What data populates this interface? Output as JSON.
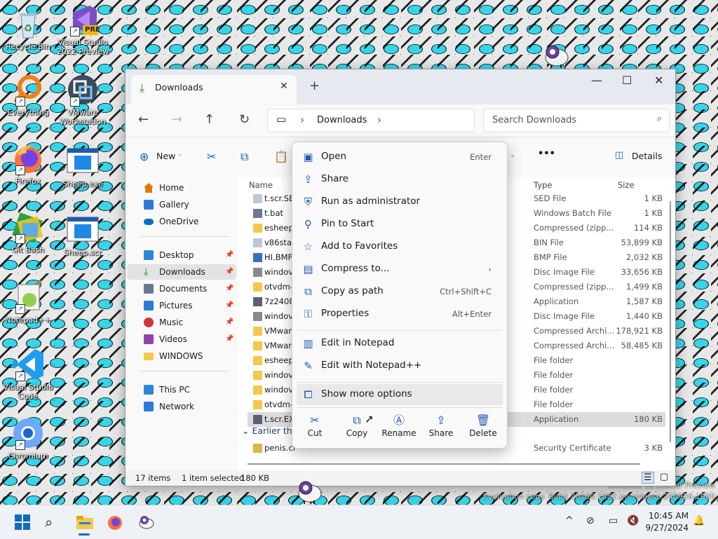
{
  "desktop_icons": [
    {
      "label": "Recycle Bin"
    },
    {
      "label": "Visual Studio 2022 Preview",
      "badge": "PRE"
    },
    {
      "label": "Everything"
    },
    {
      "label": "VMware Workstation"
    },
    {
      "label": "Firefox"
    },
    {
      "label": "Sheep.exe"
    },
    {
      "label": "Git Bash"
    },
    {
      "label": "Sheep.scr"
    },
    {
      "label": "Notepad++"
    },
    {
      "label": "Visual Studio Code"
    },
    {
      "label": "Chromium"
    }
  ],
  "window": {
    "tab_title": "Downloads",
    "tab_close": "✕",
    "new_tab": "+",
    "address": {
      "pc_glyph": "▭",
      "sep": "›",
      "location": "Downloads",
      "sep2": "›"
    },
    "search_placeholder": "Search Downloads",
    "toolbar": {
      "new_label": "New",
      "more": "•••",
      "details_label": "Details"
    },
    "nav_pane": [
      {
        "label": "Home",
        "color": "#e07b00"
      },
      {
        "label": "Gallery",
        "color": "#2b79d8"
      },
      {
        "label": "OneDrive",
        "color": "#0f6cbd"
      },
      {
        "label": "Desktop",
        "color": "#2b88d8",
        "pinned": true
      },
      {
        "label": "Downloads",
        "color": "#1a7f37",
        "pinned": true,
        "selected": true
      },
      {
        "label": "Documents",
        "color": "#6b7a90",
        "pinned": true
      },
      {
        "label": "Pictures",
        "color": "#2b79d8",
        "pinned": true
      },
      {
        "label": "Music",
        "color": "#d13438",
        "pinned": true
      },
      {
        "label": "Videos",
        "color": "#8e44ad",
        "pinned": true
      },
      {
        "label": "WINDOWS",
        "color": "#f2c94c"
      },
      {
        "label": "This PC",
        "color": "#2b88d8"
      },
      {
        "label": "Network",
        "color": "#2b79d8"
      }
    ],
    "columns": {
      "name": "Name",
      "type": "Type",
      "size": "Size"
    },
    "files": [
      {
        "name": "t.scr.SE",
        "type": "SED File",
        "size": "1 KB",
        "icon": "doc"
      },
      {
        "name": "t.bat",
        "type": "Windows Batch File",
        "size": "1 KB",
        "icon": "gear"
      },
      {
        "name": "esheep",
        "type": "Compressed (zipp...",
        "size": "114 KB",
        "icon": "zip"
      },
      {
        "name": "v86stat",
        "type": "BIN File",
        "size": "53,899 KB",
        "icon": "doc"
      },
      {
        "name": "HI.BMP",
        "type": "BMP File",
        "size": "2,032 KB",
        "icon": "img"
      },
      {
        "name": "windov",
        "type": "Disc Image File",
        "size": "33,656 KB",
        "icon": "disc"
      },
      {
        "name": "otvdm-",
        "type": "Compressed (zipp...",
        "size": "1,499 KB",
        "icon": "zip"
      },
      {
        "name": "7z2408-",
        "type": "Application",
        "size": "1,587 KB",
        "icon": "app"
      },
      {
        "name": "windov",
        "type": "Disc Image File",
        "size": "1,440 KB",
        "icon": "disc"
      },
      {
        "name": "VMwar",
        "type": "Compressed Archi...",
        "size": "178,921 KB",
        "icon": "zip"
      },
      {
        "name": "VMwar",
        "type": "Compressed Archi...",
        "size": "58,485 KB",
        "icon": "zip"
      },
      {
        "name": "esheep",
        "type": "File folder",
        "size": "",
        "icon": "folder"
      },
      {
        "name": "windov",
        "type": "File folder",
        "size": "",
        "icon": "folder"
      },
      {
        "name": "windov",
        "type": "File folder",
        "size": "",
        "icon": "folder"
      },
      {
        "name": "otvdm-",
        "type": "File folder",
        "size": "",
        "icon": "folder"
      },
      {
        "name": "t.scr.EX",
        "type": "Application",
        "size": "180 KB",
        "icon": "app",
        "selected": true
      }
    ],
    "group_earlier": "Earlier th",
    "earlier_files": [
      {
        "name": "penis.cr",
        "type": "Security Certificate",
        "size": "3 KB",
        "icon": "cert"
      }
    ],
    "status": {
      "items": "17 items",
      "selected": "1 item selected",
      "size": "180 KB"
    }
  },
  "context_menu": {
    "items": [
      {
        "label": "Open",
        "key": "Enter",
        "icon": "▣"
      },
      {
        "label": "Share",
        "key": "",
        "icon": "⇪"
      },
      {
        "label": "Run as administrator",
        "key": "",
        "icon": "⛨"
      },
      {
        "label": "Pin to Start",
        "key": "",
        "icon": "⚲"
      },
      {
        "label": "Add to Favorites",
        "key": "",
        "icon": "☆"
      },
      {
        "label": "Compress to...",
        "key": "›",
        "icon": "▤"
      },
      {
        "label": "Copy as path",
        "key": "Ctrl+Shift+C",
        "icon": "⧉"
      },
      {
        "label": "Properties",
        "key": "Alt+Enter",
        "icon": "⚿"
      }
    ],
    "items2": [
      {
        "label": "Edit in Notepad",
        "icon": "▥"
      },
      {
        "label": "Edit with Notepad++",
        "icon": "✎"
      }
    ],
    "more": {
      "label": "Show more options",
      "icon": "⧠"
    },
    "quick": [
      {
        "label": "Cut",
        "icon": "✂"
      },
      {
        "label": "Copy",
        "icon": "⧉"
      },
      {
        "label": "Rename",
        "icon": "Ⓐ"
      },
      {
        "label": "Share",
        "icon": "⇪"
      },
      {
        "label": "Delete",
        "icon": "🗑"
      }
    ]
  },
  "taskbar": {
    "tray_chevron": "^",
    "time": "10:45 AM",
    "date": "9/27/2024"
  },
  "watermark": {
    "line1": "Windows 11 Insider Preview",
    "line2": "Evaluation copy. Build 26100.1882.ge_release.240926-1900"
  }
}
